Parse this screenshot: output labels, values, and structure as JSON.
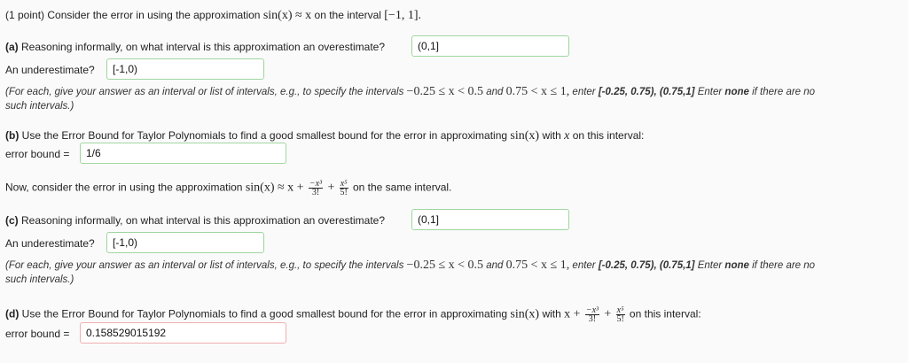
{
  "header": {
    "intro": "(1 point) Consider the error in using the approximation",
    "approx1": "sin(x) ≈ x",
    "interval_pre": "on the interval",
    "interval": "[−1, 1]."
  },
  "part_a": {
    "prefix": "(a)",
    "question": "Reasoning informally, on what interval is this approximation an overestimate?",
    "over_value": "(0,1]",
    "under_label": "An underestimate?",
    "under_value": "[-1,0)"
  },
  "note": {
    "text1": "(For each, give your answer as an interval or list of intervals, e.g., to specify the intervals",
    "ex1": "−0.25 ≤ x < 0.5",
    "and": "and",
    "ex2": "0.75 < x ≤ 1,",
    "enter": "enter",
    "example": "[-0.25, 0.75), (0.75,1]",
    "enter2": "Enter",
    "none": "none",
    "text2": "if there are no",
    "text3": "such intervals.)"
  },
  "part_b": {
    "prefix": "(b)",
    "question": "Use the Error Bound for Taylor Polynomials to find a good smallest bound for the error in approximating",
    "func": "sin(x)",
    "with": "with",
    "x": "x",
    "tail": "on this interval:",
    "label": "error bound =",
    "value": "1/6"
  },
  "now": {
    "intro": "Now, consider the error in using the approximation",
    "approx": "sin(x) ≈ x +",
    "n1": "−x³",
    "d1": "3!",
    "plus": "+",
    "n2": "x⁵",
    "d2": "5!",
    "tail": "on the same interval."
  },
  "part_c": {
    "prefix": "(c)",
    "question": "Reasoning informally, on what interval is this approximation an overestimate?",
    "over_value": "(0,1]",
    "under_label": "An underestimate?",
    "under_value": "[-1,0)"
  },
  "part_d": {
    "prefix": "(d)",
    "question": "Use the Error Bound for Taylor Polynomials to find a good smallest bound for the error in approximating",
    "func": "sin(x)",
    "with": "with",
    "x_plus": "x +",
    "tail": "on this interval:",
    "label": "error bound =",
    "value": "0.158529015192"
  }
}
